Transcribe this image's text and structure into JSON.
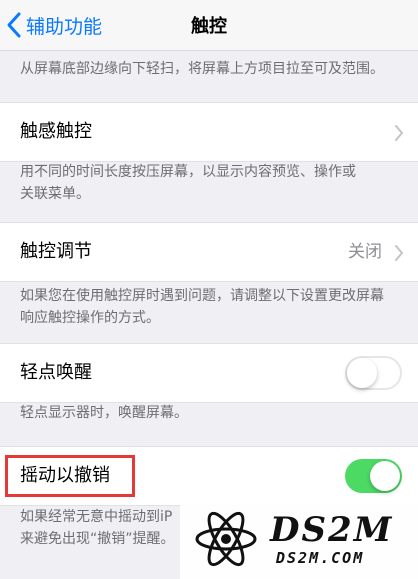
{
  "nav": {
    "back_label": "辅助功能",
    "title": "触控"
  },
  "top_note": "从屏幕底部边缘向下轻扫，将屏幕上方项目拉至可及范围。",
  "haptic_touch": {
    "label": "触感触控",
    "note_line1": "用不同的时间长度按压屏幕，以显示内容预览、操作或",
    "note_line2": "关联菜单。"
  },
  "touch_accommodations": {
    "label": "触控调节",
    "value": "关闭",
    "note_line1": "如果您在使用触控屏时遇到问题，请调整以下设置更改屏幕",
    "note_line2": "响应触控操作的方式。"
  },
  "tap_to_wake": {
    "label": "轻点唤醒",
    "enabled": false,
    "note": "轻点显示器时，唤醒屏幕。"
  },
  "shake_to_undo": {
    "label": "摇动以撤销",
    "enabled": true,
    "note_line1": "如果经常无意中摇动到iP",
    "note_line2": "来避免出现“撤销”提醒。"
  },
  "watermark": {
    "brand": "DS2M",
    "site": "DS2M.COM"
  },
  "colors": {
    "accent": "#0a7aff",
    "switch_on": "#4cd964",
    "highlight": "#e53935"
  },
  "icons": {
    "back": "chevron-left-icon",
    "disclosure": "chevron-right-icon"
  }
}
